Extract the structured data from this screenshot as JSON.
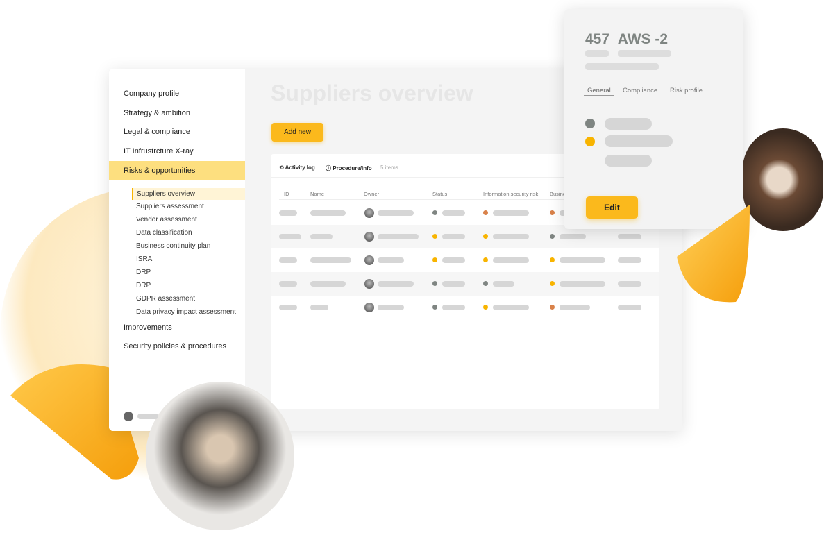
{
  "sidebar": {
    "items": [
      {
        "label": "Company profile"
      },
      {
        "label": "Strategy & ambition"
      },
      {
        "label": "Legal & compliance"
      },
      {
        "label": "IT Infrustrcture X-ray"
      },
      {
        "label": "Risks & opportunities",
        "active": true
      }
    ],
    "subitems": [
      "Suppliers overview",
      "Suppliers assessment",
      "Vendor assessment",
      "Data classification",
      "Business continuity plan",
      "ISRA",
      "DRP",
      "DRP",
      "GDPR assessment",
      "Data privacy impact assessment"
    ],
    "bottom_items": [
      "Improvements",
      "Security policies & procedures"
    ]
  },
  "main": {
    "title": "Suppliers overview",
    "add_new": "Add new",
    "toolbar": {
      "activity_log": "Activity log",
      "procedure_info": "Procedure/info",
      "count": "5 items"
    },
    "columns": [
      "ID",
      "Name",
      "Owner",
      "Status",
      "Information security risk",
      "Busine"
    ],
    "row_dots": [
      [
        "grey",
        "orange",
        "orange"
      ],
      [
        "yellow",
        "yellow",
        "grey"
      ],
      [
        "yellow",
        "yellow",
        "yellow"
      ],
      [
        "grey",
        "grey",
        "yellow"
      ],
      [
        "grey",
        "yellow",
        "orange"
      ]
    ]
  },
  "panel": {
    "id": "457",
    "name": "AWS -2",
    "tabs": [
      "General",
      "Compliance",
      "Risk profile"
    ],
    "active_tab": "General",
    "edit": "Edit"
  },
  "colors": {
    "accent": "#fbb91c",
    "grey": "#7f8582",
    "orange": "#d9824a",
    "yellow": "#f8b400"
  }
}
